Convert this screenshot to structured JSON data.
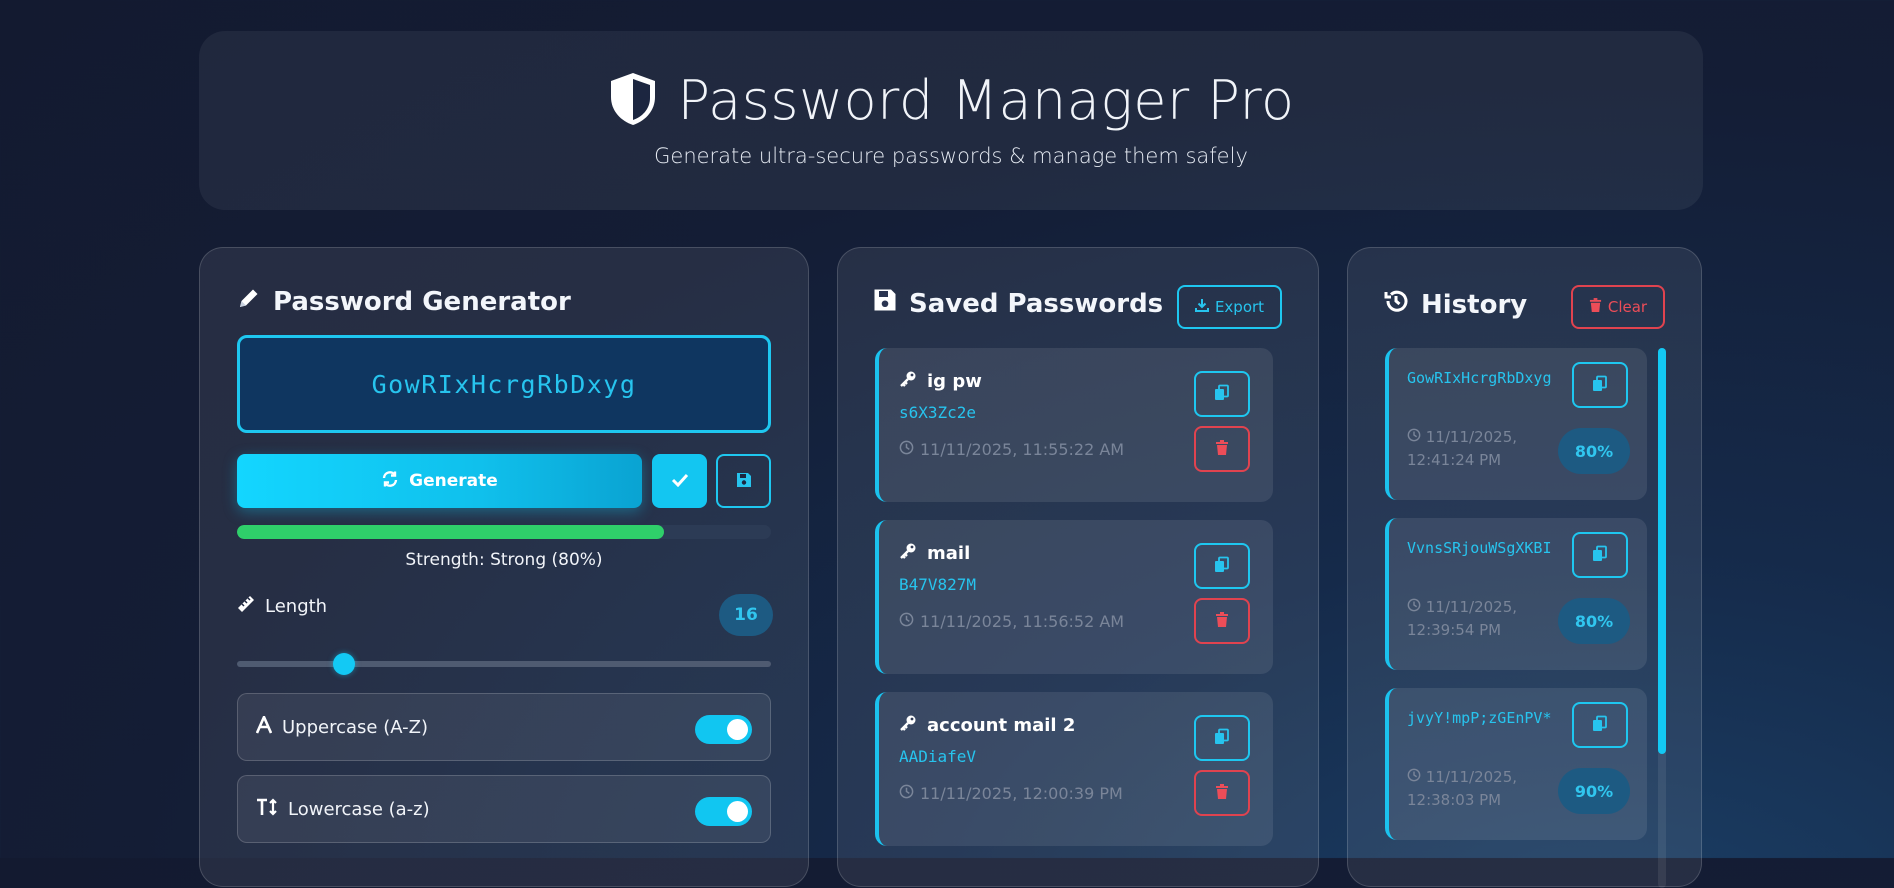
{
  "header": {
    "icon": "shield-icon",
    "title": "Password Manager Pro",
    "subtitle": "Generate ultra-secure passwords & manage them safely"
  },
  "generator": {
    "title_icon": "pencil-icon",
    "title": "Password Generator",
    "password": "GowRIxHcrgRbDxyg",
    "generate_label": "Generate",
    "strength_fraction": 0.8,
    "strength_text": "Strength: Strong (80%)",
    "length_label": "Length",
    "length_value": "16",
    "length_min": 4,
    "length_max": 64,
    "options": [
      {
        "icon": "font-icon",
        "label": "Uppercase (A-Z)",
        "enabled": true
      },
      {
        "icon": "text-height-icon",
        "label": "Lowercase (a-z)",
        "enabled": true
      }
    ]
  },
  "saved": {
    "title_icon": "floppy-icon",
    "title": "Saved Passwords",
    "export_label": "Export",
    "items": [
      {
        "name": "ig pw",
        "password": "s6X3Zc2e",
        "time": "11/11/2025, 11:55:22 AM"
      },
      {
        "name": "mail",
        "password": "B47V827M",
        "time": "11/11/2025, 11:56:52 AM"
      },
      {
        "name": "account mail 2",
        "password": "AADiafeV",
        "time": "11/11/2025, 12:00:39 PM"
      }
    ]
  },
  "history": {
    "title_icon": "history-icon",
    "title": "History",
    "clear_label": "Clear",
    "items": [
      {
        "password": "GowRIxHcrgRbDxyg",
        "time": "11/11/2025, 12:41:24 PM",
        "strength": "80%"
      },
      {
        "password": "VvnsSRjouWSgXKBI",
        "time": "11/11/2025, 12:39:54 PM",
        "strength": "80%"
      },
      {
        "password": "jvyY!mpP;zGEnPV*",
        "time": "11/11/2025, 12:38:03 PM",
        "strength": "90%"
      }
    ]
  },
  "colors": {
    "accent": "#13c6f1",
    "danger": "#e0434f",
    "success": "#2fcf6a"
  }
}
